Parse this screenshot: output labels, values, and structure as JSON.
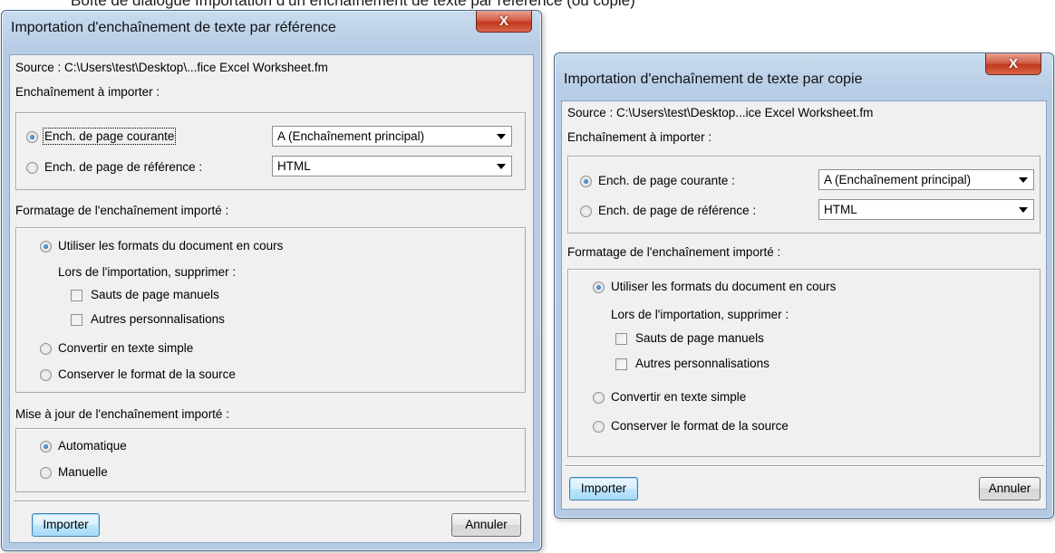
{
  "caption": "Boîte de dialogue Importation d’un enchaînement de texte par référence (ou copie)",
  "dialog_ref": {
    "title": "Importation d'enchaînement de texte par référence",
    "close_glyph": "X",
    "source": "Source : C:\\Users\\test\\Desktop\\...fice Excel Worksheet.fm",
    "flow_section": "Enchaînement à importer :",
    "current_page_label": "Ench. de page courante",
    "current_page_value": "A (Enchaînement principal)",
    "ref_page_label": "Ench. de page de référence :",
    "ref_page_value": "HTML",
    "format_section": "Formatage de l'enchaînement importé :",
    "use_formats": "Utiliser les formats du document en cours",
    "remove_label": "Lors de l'importation, supprimer :",
    "manual_breaks": "Sauts de page manuels",
    "other_overrides": "Autres personnalisations",
    "plain_text": "Convertir en texte simple",
    "keep_format": "Conserver le format de la source",
    "update_section": "Mise à jour de l'enchaînement importé :",
    "automatic": "Automatique",
    "manual": "Manuelle",
    "import_button": "Importer",
    "cancel_button": "Annuler"
  },
  "dialog_copy": {
    "title": "Importation d'enchaînement de texte par copie",
    "close_glyph": "X",
    "source": "Source : C:\\Users\\test\\Desktop...ice Excel Worksheet.fm",
    "flow_section": "Enchaînement à importer :",
    "current_page_label": "Ench. de page courante :",
    "current_page_value": "A (Enchaînement principal)",
    "ref_page_label": "Ench. de page de référence :",
    "ref_page_value": "HTML",
    "format_section": "Formatage de l'enchaînement importé :",
    "use_formats": "Utiliser les formats du document en cours",
    "remove_label": "Lors de l'importation, supprimer :",
    "manual_breaks": "Sauts de page manuels",
    "other_overrides": "Autres personnalisations",
    "plain_text": "Convertir en texte simple",
    "keep_format": "Conserver le format de la source",
    "import_button": "Importer",
    "cancel_button": "Annuler"
  }
}
